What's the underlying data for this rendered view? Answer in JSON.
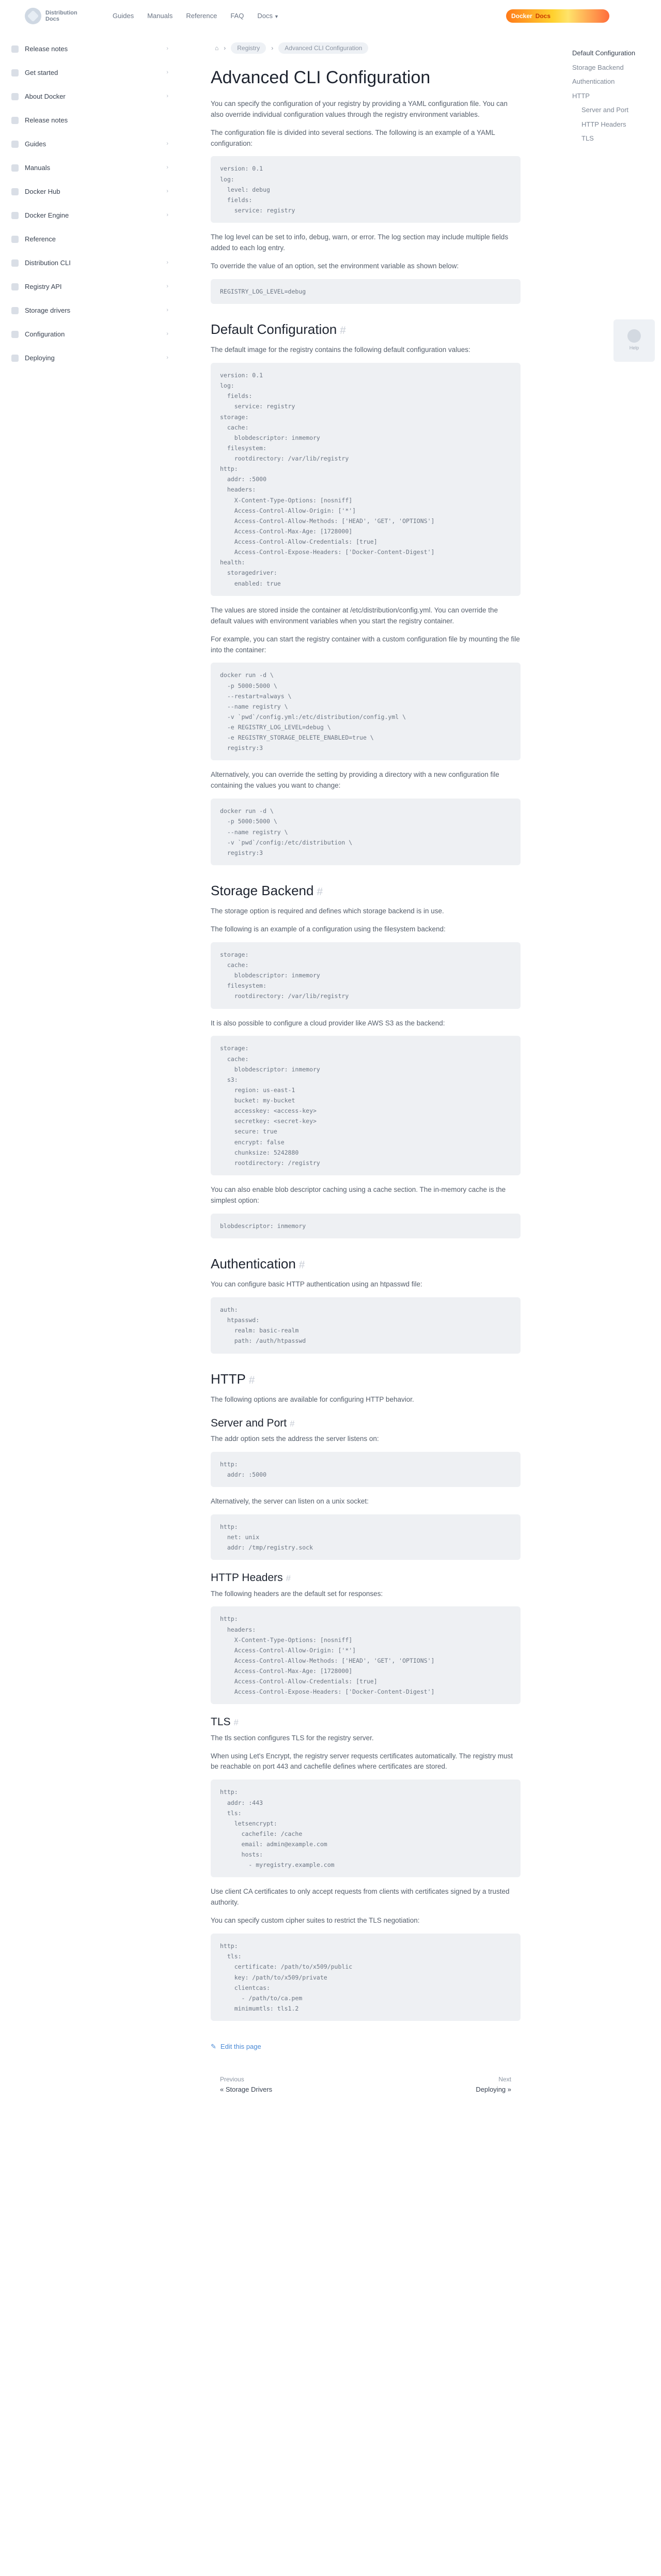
{
  "header": {
    "logo_line1": "Distribution",
    "logo_line2": "Docs",
    "nav": [
      "Guides",
      "Manuals",
      "Reference",
      "FAQ",
      "Docs"
    ],
    "banner_left": "Docker",
    "banner_right": "Docs"
  },
  "sidebar": {
    "items": [
      {
        "label": "Release notes",
        "chevron": true
      },
      {
        "label": "Get started",
        "chevron": true
      },
      {
        "label": "About Docker",
        "chevron": true
      },
      {
        "label": "Release notes",
        "chevron": false
      },
      {
        "label": "Guides",
        "chevron": true
      },
      {
        "label": "Manuals",
        "chevron": true
      },
      {
        "label": "Docker Hub",
        "chevron": true
      },
      {
        "label": "Docker Engine",
        "chevron": true
      },
      {
        "label": "Reference",
        "chevron": false
      },
      {
        "label": "Distribution CLI",
        "chevron": true
      },
      {
        "label": "Registry API",
        "chevron": true
      },
      {
        "label": "Storage drivers",
        "chevron": true
      },
      {
        "label": "Configuration",
        "chevron": true
      },
      {
        "label": "Deploying",
        "chevron": true
      }
    ]
  },
  "breadcrumbs": [
    "Home",
    "Registry",
    "Advanced CLI Configuration"
  ],
  "page_title": "Advanced CLI Configuration",
  "intro": [
    "You can specify the configuration of your registry by providing a YAML configuration file. You can also override individual configuration values through the registry environment variables.",
    "The configuration file is divided into several sections. The following is an example of a YAML configuration:"
  ],
  "code_intro": "version: 0.1\nlog:\n  level: debug\n  fields:\n    service: registry",
  "after_code_intro": [
    "The log level can be set to info, debug, warn, or error. The log section may include multiple fields added to each log entry.",
    "To override the value of an option, set the environment variable as shown below:"
  ],
  "code_env": "REGISTRY_LOG_LEVEL=debug",
  "section_default": "Default Configuration",
  "default_desc": "The default image for the registry contains the following default configuration values:",
  "code_default": "version: 0.1\nlog:\n  fields:\n    service: registry\nstorage:\n  cache:\n    blobdescriptor: inmemory\n  filesystem:\n    rootdirectory: /var/lib/registry\nhttp:\n  addr: :5000\n  headers:\n    X-Content-Type-Options: [nosniff]\n    Access-Control-Allow-Origin: ['*']\n    Access-Control-Allow-Methods: ['HEAD', 'GET', 'OPTIONS']\n    Access-Control-Max-Age: [1728000]\n    Access-Control-Allow-Credentials: [true]\n    Access-Control-Expose-Headers: ['Docker-Content-Digest']\nhealth:\n  storagedriver:\n    enabled: true",
  "after_default": [
    "The values are stored inside the container at /etc/distribution/config.yml. You can override the default values with environment variables when you start the registry container.",
    "For example, you can start the registry container with a custom configuration file by mounting the file into the container:"
  ],
  "code_run1": "docker run -d \\\n  -p 5000:5000 \\\n  --restart=always \\\n  --name registry \\\n  -v `pwd`/config.yml:/etc/distribution/config.yml \\\n  -e REGISTRY_LOG_LEVEL=debug \\\n  -e REGISTRY_STORAGE_DELETE_ENABLED=true \\\n  registry:3",
  "after_run1": "Alternatively, you can override the setting by providing a directory with a new configuration file containing the values you want to change:",
  "code_run2": "docker run -d \\\n  -p 5000:5000 \\\n  --name registry \\\n  -v `pwd`/config:/etc/distribution \\\n  registry:3",
  "section_storage": "Storage Backend",
  "storage_desc": [
    "The storage option is required and defines which storage backend is in use.",
    "The following is an example of a configuration using the filesystem backend:"
  ],
  "code_storage1": "storage:\n  cache:\n    blobdescriptor: inmemory\n  filesystem:\n    rootdirectory: /var/lib/registry",
  "storage_s3_desc": "It is also possible to configure a cloud provider like AWS S3 as the backend:",
  "code_storage2": "storage:\n  cache:\n    blobdescriptor: inmemory\n  s3:\n    region: us-east-1\n    bucket: my-bucket\n    accesskey: <access-key>\n    secretkey: <secret-key>\n    secure: true\n    encrypt: false\n    chunksize: 5242880\n    rootdirectory: /registry",
  "storage_cache_desc": "You can also enable blob descriptor caching using a cache section. The in-memory cache is the simplest option:",
  "code_cache": "blobdescriptor: inmemory",
  "section_auth": "Authentication",
  "auth_desc": "You can configure basic HTTP authentication using an htpasswd file:",
  "code_auth": "auth:\n  htpasswd:\n    realm: basic-realm\n    path: /auth/htpasswd",
  "section_http": "HTTP",
  "http_desc": "The following options are available for configuring HTTP behavior.",
  "section_server": "Server and Port",
  "server_desc": "The addr option sets the address the server listens on:",
  "code_addr": "http:\n  addr: :5000",
  "server_secret_desc": "Alternatively, the server can listen on a unix socket:",
  "code_secret": "http:\n  net: unix\n  addr: /tmp/registry.sock",
  "section_headers": "HTTP Headers",
  "headers_desc": "The following headers are the default set for responses:",
  "code_headers": "http:\n  headers:\n    X-Content-Type-Options: [nosniff]\n    Access-Control-Allow-Origin: ['*']\n    Access-Control-Allow-Methods: ['HEAD', 'GET', 'OPTIONS']\n    Access-Control-Max-Age: [1728000]\n    Access-Control-Allow-Credentials: [true]\n    Access-Control-Expose-Headers: ['Docker-Content-Digest']",
  "section_tls": "TLS",
  "tls_desc": [
    "The tls section configures TLS for the registry server.",
    "When using Let's Encrypt, the registry server requests certificates automatically. The registry must be reachable on port 443 and cachefile defines where certificates are stored."
  ],
  "code_tls1": "http:\n  addr: :443\n  tls:\n    letsencrypt:\n      cachefile: /cache\n      email: admin@example.com\n      hosts:\n        - myregistry.example.com",
  "tls_client_desc": [
    "Use client CA certificates to only accept requests from clients with certificates signed by a trusted authority.",
    "You can specify custom cipher suites to restrict the TLS negotiation:"
  ],
  "code_tls2": "http:\n  tls:\n    certificate: /path/to/x509/public\n    key: /path/to/x509/private\n    clientcas:\n      - /path/to/ca.pem\n    minimumtls: tls1.2",
  "edit_link": "Edit this page",
  "pager": {
    "prev_label": "Previous",
    "prev_title": "« Storage Drivers",
    "next_label": "Next",
    "next_title": "Deploying »"
  },
  "toc": [
    {
      "label": "Default Configuration",
      "sub": false,
      "active": true
    },
    {
      "label": "Storage Backend",
      "sub": false,
      "active": false
    },
    {
      "label": "Authentication",
      "sub": false,
      "active": false
    },
    {
      "label": "HTTP",
      "sub": false,
      "active": false
    },
    {
      "label": "Server and Port",
      "sub": true,
      "active": false
    },
    {
      "label": "HTTP Headers",
      "sub": true,
      "active": false
    },
    {
      "label": "TLS",
      "sub": true,
      "active": false
    }
  ],
  "help_label": "Help"
}
